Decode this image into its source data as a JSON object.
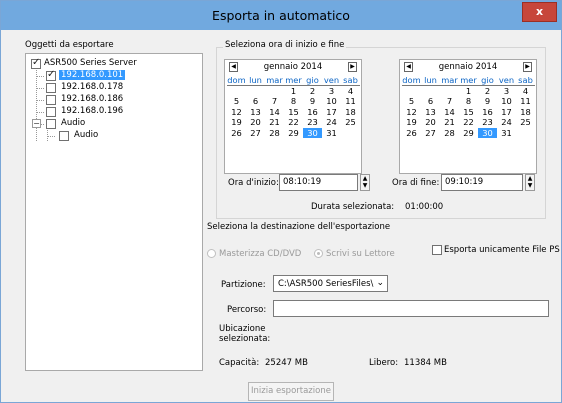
{
  "window": {
    "title": "Esporta in automatico",
    "close_label": "x"
  },
  "objects": {
    "label": "Oggetti da esportare",
    "tree": [
      {
        "text": "ASR500 Series Server",
        "checked": true
      },
      {
        "text": "192.168.0.101",
        "checked": true,
        "selected": true
      },
      {
        "text": "192.168.0.178",
        "checked": false
      },
      {
        "text": "192.168.0.186",
        "checked": false
      },
      {
        "text": "192.168.0.196",
        "checked": false
      },
      {
        "text": "Audio",
        "checked": false
      },
      {
        "text": "Audio",
        "checked": false
      }
    ]
  },
  "time_group": {
    "label": "Seleziona ora di inizio e fine",
    "calendars": [
      {
        "month": "gennaio 2014",
        "days_of_week": [
          "dom",
          "lun",
          "mar",
          "mer",
          "gio",
          "ven",
          "sab"
        ],
        "weeks": [
          [
            "",
            "",
            "",
            "1",
            "2",
            "3",
            "4"
          ],
          [
            "5",
            "6",
            "7",
            "8",
            "9",
            "10",
            "11"
          ],
          [
            "12",
            "13",
            "14",
            "15",
            "16",
            "17",
            "18"
          ],
          [
            "19",
            "20",
            "21",
            "22",
            "23",
            "24",
            "25"
          ],
          [
            "26",
            "27",
            "28",
            "29",
            "30",
            "31",
            ""
          ]
        ],
        "selected_day": "30",
        "time_label": "Ora d'inizio:",
        "time_value": "08:10:19"
      },
      {
        "month": "gennaio 2014",
        "days_of_week": [
          "dom",
          "lun",
          "mar",
          "mer",
          "gio",
          "ven",
          "sab"
        ],
        "weeks": [
          [
            "",
            "",
            "",
            "1",
            "2",
            "3",
            "4"
          ],
          [
            "5",
            "6",
            "7",
            "8",
            "9",
            "10",
            "11"
          ],
          [
            "12",
            "13",
            "14",
            "15",
            "16",
            "17",
            "18"
          ],
          [
            "19",
            "20",
            "21",
            "22",
            "23",
            "24",
            "25"
          ],
          [
            "26",
            "27",
            "28",
            "29",
            "30",
            "31",
            ""
          ]
        ],
        "selected_day": "30",
        "time_label": "Ora di fine:",
        "time_value": "09:10:19"
      }
    ],
    "duration_label": "Durata selezionata:",
    "duration_value": "01:00:00"
  },
  "destination": {
    "label": "Seleziona la destinazione dell'esportazione",
    "radio_burn": "Masterizza CD/DVD",
    "radio_write": "Scrivi su Lettore",
    "checkbox_ps": "Esporta unicamente File PS",
    "partition_label": "Partizione:",
    "partition_value": "C:\\ASR500 SeriesFiles\\",
    "path_label": "Percorso:",
    "path_value": "",
    "location_label_line1": "Ubicazione",
    "location_label_line2": "selezionata:",
    "location_value": "",
    "capacity_label": "Capacità:",
    "capacity_value": "25247 MB",
    "free_label": "Libero:",
    "free_value": "11384 MB"
  },
  "start_button": "Inizia esportazione",
  "colors": {
    "titlebar": "#71a9df",
    "selection": "#3399ff",
    "day_of_week": "#0b64c5",
    "close": "#c7463a"
  }
}
